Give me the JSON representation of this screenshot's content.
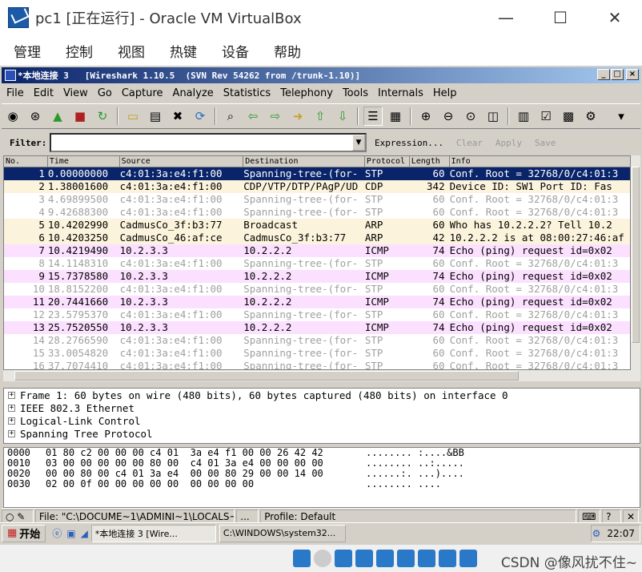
{
  "outer": {
    "title": "pc1 [正在运行] - Oracle VM VirtualBox",
    "menu": [
      "管理",
      "控制",
      "视图",
      "热键",
      "设备",
      "帮助"
    ],
    "minimize": "—",
    "maximize": "☐",
    "close": "✕"
  },
  "wireshark": {
    "title": "*本地连接 3   [Wireshark 1.10.5  (SVN Rev 54262 from /trunk-1.10)]",
    "menu": [
      "File",
      "Edit",
      "View",
      "Go",
      "Capture",
      "Analyze",
      "Statistics",
      "Telephony",
      "Tools",
      "Internals",
      "Help"
    ],
    "filter": {
      "label": "Filter:",
      "value": "",
      "expression": "Expression...",
      "clear": "Clear",
      "apply": "Apply",
      "save": "Save"
    },
    "columns": [
      "No.",
      "Time",
      "Source",
      "Destination",
      "Protocol",
      "Length",
      "Info"
    ],
    "packets": [
      {
        "no": "1",
        "time": "0.00000000",
        "src": "c4:01:3a:e4:f1:00",
        "dst": "Spanning-tree-(for-",
        "proto": "STP",
        "len": "60",
        "info": "Conf. Root = 32768/0/c4:01:3",
        "bg": "#0a246a",
        "fg": "#ffffff"
      },
      {
        "no": "2",
        "time": "1.38001600",
        "src": "c4:01:3a:e4:f1:00",
        "dst": "CDP/VTP/DTP/PAgP/UD",
        "proto": "CDP",
        "len": "342",
        "info": "Device ID: SW1  Port ID: Fas",
        "bg": "#fcf3dc",
        "fg": "#000000"
      },
      {
        "no": "3",
        "time": "4.69899500",
        "src": "c4:01:3a:e4:f1:00",
        "dst": "Spanning-tree-(for-",
        "proto": "STP",
        "len": "60",
        "info": "Conf. Root = 32768/0/c4:01:3",
        "bg": "#ffffff",
        "fg": "#a0a0a0"
      },
      {
        "no": "4",
        "time": "9.42688300",
        "src": "c4:01:3a:e4:f1:00",
        "dst": "Spanning-tree-(for-",
        "proto": "STP",
        "len": "60",
        "info": "Conf. Root = 32768/0/c4:01:3",
        "bg": "#ffffff",
        "fg": "#a0a0a0"
      },
      {
        "no": "5",
        "time": "10.4202990",
        "src": "CadmusCo_3f:b3:77",
        "dst": "Broadcast",
        "proto": "ARP",
        "len": "60",
        "info": "Who has 10.2.2.2?  Tell 10.2",
        "bg": "#fcf3dc",
        "fg": "#000000"
      },
      {
        "no": "6",
        "time": "10.4203250",
        "src": "CadmusCo_46:af:ce",
        "dst": "CadmusCo_3f:b3:77",
        "proto": "ARP",
        "len": "42",
        "info": "10.2.2.2 is at 08:00:27:46:af",
        "bg": "#fcf3dc",
        "fg": "#000000"
      },
      {
        "no": "7",
        "time": "10.4219490",
        "src": "10.2.3.3",
        "dst": "10.2.2.2",
        "proto": "ICMP",
        "len": "74",
        "info": "Echo (ping) request  id=0x02",
        "bg": "#fce0ff",
        "fg": "#000000"
      },
      {
        "no": "8",
        "time": "14.1148310",
        "src": "c4:01:3a:e4:f1:00",
        "dst": "Spanning-tree-(for-",
        "proto": "STP",
        "len": "60",
        "info": "Conf. Root = 32768/0/c4:01:3",
        "bg": "#ffffff",
        "fg": "#a0a0a0"
      },
      {
        "no": "9",
        "time": "15.7378580",
        "src": "10.2.3.3",
        "dst": "10.2.2.2",
        "proto": "ICMP",
        "len": "74",
        "info": "Echo (ping) request  id=0x02",
        "bg": "#fce0ff",
        "fg": "#000000"
      },
      {
        "no": "10",
        "time": "18.8152200",
        "src": "c4:01:3a:e4:f1:00",
        "dst": "Spanning-tree-(for-",
        "proto": "STP",
        "len": "60",
        "info": "Conf. Root = 32768/0/c4:01:3",
        "bg": "#ffffff",
        "fg": "#a0a0a0"
      },
      {
        "no": "11",
        "time": "20.7441660",
        "src": "10.2.3.3",
        "dst": "10.2.2.2",
        "proto": "ICMP",
        "len": "74",
        "info": "Echo (ping) request  id=0x02",
        "bg": "#fce0ff",
        "fg": "#000000"
      },
      {
        "no": "12",
        "time": "23.5795370",
        "src": "c4:01:3a:e4:f1:00",
        "dst": "Spanning-tree-(for-",
        "proto": "STP",
        "len": "60",
        "info": "Conf. Root = 32768/0/c4:01:3",
        "bg": "#ffffff",
        "fg": "#a0a0a0"
      },
      {
        "no": "13",
        "time": "25.7520550",
        "src": "10.2.3.3",
        "dst": "10.2.2.2",
        "proto": "ICMP",
        "len": "74",
        "info": "Echo (ping) request  id=0x02",
        "bg": "#fce0ff",
        "fg": "#000000"
      },
      {
        "no": "14",
        "time": "28.2766590",
        "src": "c4:01:3a:e4:f1:00",
        "dst": "Spanning-tree-(for-",
        "proto": "STP",
        "len": "60",
        "info": "Conf. Root = 32768/0/c4:01:3",
        "bg": "#ffffff",
        "fg": "#a0a0a0"
      },
      {
        "no": "15",
        "time": "33.0054820",
        "src": "c4:01:3a:e4:f1:00",
        "dst": "Spanning-tree-(for-",
        "proto": "STP",
        "len": "60",
        "info": "Conf. Root = 32768/0/c4:01:3",
        "bg": "#ffffff",
        "fg": "#a0a0a0"
      },
      {
        "no": "16",
        "time": "37.7074410",
        "src": "c4:01:3a:e4:f1:00",
        "dst": "Spanning-tree-(for-",
        "proto": "STP",
        "len": "60",
        "info": "Conf. Root = 32768/0/c4:01:3",
        "bg": "#ffffff",
        "fg": "#a0a0a0"
      }
    ],
    "details": [
      "Frame 1: 60 bytes on wire (480 bits), 60 bytes captured (480 bits) on interface 0",
      "IEEE 802.3 Ethernet",
      "Logical-Link Control",
      "Spanning Tree Protocol"
    ],
    "hex": [
      {
        "a": "0000",
        "x": "01 80 c2 00 00 00 c4 01  3a e4 f1 00 00 26 42 42",
        "s": "........ :....&BB"
      },
      {
        "a": "0010",
        "x": "03 00 00 00 00 00 80 00  c4 01 3a e4 00 00 00 00",
        "s": "........ ..:....."
      },
      {
        "a": "0020",
        "x": "00 00 80 00 c4 01 3a e4  00 00 80 29 00 00 14 00",
        "s": "......:. ...)...."
      },
      {
        "a": "0030",
        "x": "02 00 0f 00 00 00 00 00  00 00 00 00",
        "s": "........ ...."
      }
    ],
    "status": {
      "file": "File: \"C:\\DOCUME~1\\ADMINI~1\\LOCALS~...",
      "dots": "...",
      "profile": "Profile: Default"
    }
  },
  "taskbar": {
    "start": "开始",
    "tasks": [
      "*本地连接 3    [Wire...",
      "C:\\WINDOWS\\system32..."
    ],
    "clock": "22:07"
  },
  "watermark": "CSDN @像风扰不住~"
}
